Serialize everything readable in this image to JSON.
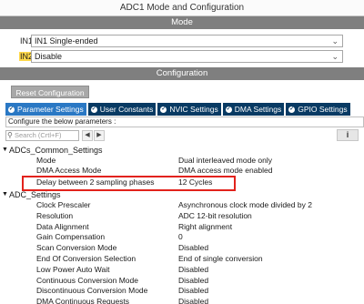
{
  "window": {
    "title": "ADC1 Mode and Configuration"
  },
  "mode_section": {
    "label": "Mode"
  },
  "mode_rows": [
    {
      "label": "IN1",
      "value": "IN1 Single-ended"
    },
    {
      "label": "IN2",
      "value": "Disable"
    }
  ],
  "config_section": {
    "label": "Configuration"
  },
  "reset_button": {
    "label": "Reset Configuration"
  },
  "tabs": [
    {
      "label": "Parameter Settings"
    },
    {
      "label": "User Constants"
    },
    {
      "label": "NVIC Settings"
    },
    {
      "label": "DMA Settings"
    },
    {
      "label": "GPIO Settings"
    }
  ],
  "configure_hint": "Configure the below parameters :",
  "search": {
    "placeholder": "Search (Crtl+F)"
  },
  "info_icon": "i",
  "groups": [
    {
      "name": "ADCs_Common_Settings",
      "params": [
        {
          "name": "Mode",
          "value": "Dual interleaved mode only"
        },
        {
          "name": "DMA Access Mode",
          "value": "DMA access mode enabled"
        },
        {
          "name": "Delay between 2 sampling phases",
          "value": "12 Cycles"
        }
      ]
    },
    {
      "name": "ADC_Settings",
      "params": [
        {
          "name": "Clock Prescaler",
          "value": "Asynchronous clock mode divided by 2"
        },
        {
          "name": "Resolution",
          "value": "ADC 12-bit resolution"
        },
        {
          "name": "Data Alignment",
          "value": "Right alignment"
        },
        {
          "name": "Gain Compensation",
          "value": "0"
        },
        {
          "name": "Scan Conversion Mode",
          "value": "Disabled"
        },
        {
          "name": "End Of Conversion Selection",
          "value": "End of single conversion"
        },
        {
          "name": "Low Power Auto Wait",
          "value": "Disabled"
        },
        {
          "name": "Continuous Conversion Mode",
          "value": "Disabled"
        },
        {
          "name": "Discontinuous Conversion Mode",
          "value": "Disabled"
        },
        {
          "name": "DMA Continuous Requests",
          "value": "Disabled"
        }
      ]
    }
  ],
  "colors": {
    "section_band": "#7f7f7f",
    "tab_bg": "#083a63",
    "tab_active": "#2a78c4",
    "highlight_border": "#e2221c",
    "in2_highlight": "#ffd84a"
  }
}
